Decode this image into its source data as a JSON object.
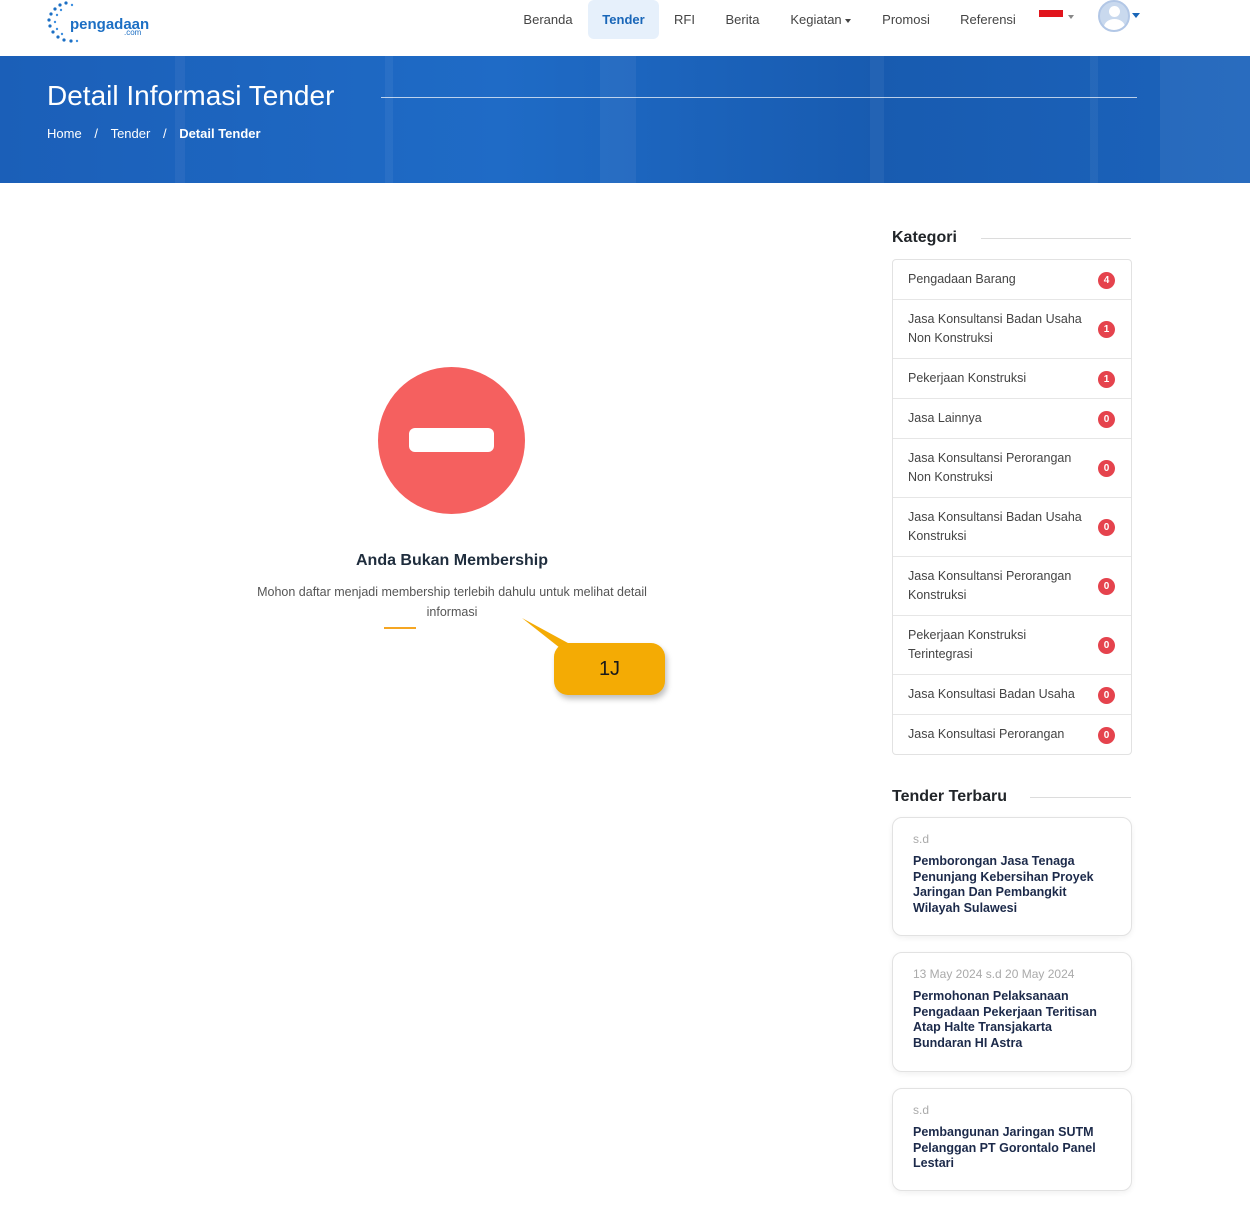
{
  "header": {
    "logo_text": "pengadaan",
    "logo_sub": ".com",
    "nav": [
      {
        "label": "Beranda",
        "active": false
      },
      {
        "label": "Tender",
        "active": true
      },
      {
        "label": "RFI",
        "active": false
      },
      {
        "label": "Berita",
        "active": false
      },
      {
        "label": "Kegiatan",
        "active": false
      },
      {
        "label": "Promosi",
        "active": false
      },
      {
        "label": "Referensi",
        "active": false
      }
    ],
    "flag_icon": "indonesia-flag-icon",
    "avatar_icon": "user-avatar-icon"
  },
  "banner": {
    "title": "Detail Informasi Tender",
    "breadcrumb": [
      "Home",
      "Tender",
      "Detail Tender"
    ],
    "separator": "/"
  },
  "notice": {
    "icon": "no-entry-icon",
    "title": "Anda Bukan Membership",
    "message": "Mohon daftar menjadi membership terlebih dahulu untuk melihat detail informasi"
  },
  "callout": {
    "label": "1J"
  },
  "sidebar": {
    "kategori_title": "Kategori",
    "categories": [
      {
        "label": "Pengadaan Barang",
        "count": "4"
      },
      {
        "label": "Jasa Konsultansi Badan Usaha Non Konstruksi",
        "count": "1"
      },
      {
        "label": "Pekerjaan Konstruksi",
        "count": "1"
      },
      {
        "label": "Jasa Lainnya",
        "count": "0"
      },
      {
        "label": "Jasa Konsultansi Perorangan Non Konstruksi",
        "count": "0"
      },
      {
        "label": "Jasa Konsultansi Badan Usaha Konstruksi",
        "count": "0"
      },
      {
        "label": "Jasa Konsultansi Perorangan Konstruksi",
        "count": "0"
      },
      {
        "label": "Pekerjaan Konstruksi Terintegrasi",
        "count": "0"
      },
      {
        "label": "Jasa Konsultasi Badan Usaha",
        "count": "0"
      },
      {
        "label": "Jasa Konsultasi Perorangan",
        "count": "0"
      }
    ],
    "tender_title": "Tender Terbaru",
    "tenders": [
      {
        "date": "s.d",
        "name": "Pemborongan Jasa Tenaga Penunjang Kebersihan Proyek Jaringan Dan Pembangkit Wilayah Sulawesi"
      },
      {
        "date": "13 May 2024 s.d 20 May 2024",
        "name": "Permohonan Pelaksanaan Pengadaan Pekerjaan Teritisan Atap Halte Transjakarta Bundaran HI Astra"
      },
      {
        "date": "s.d",
        "name": "Pembangunan Jaringan SUTM Pelanggan PT Gorontalo Panel Lestari"
      }
    ]
  },
  "colors": {
    "primary": "#1966b8",
    "banner": "#1c63bb",
    "stop": "#f5605f",
    "badge": "#e5434d",
    "callout": "#f4ab04"
  }
}
